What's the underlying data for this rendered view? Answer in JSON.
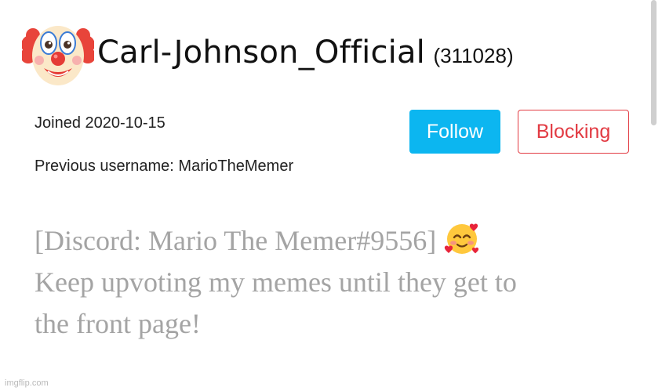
{
  "profile": {
    "username": "Carl-Johnson_Official",
    "user_id": "(311028)",
    "avatar_icon": "clown-face-emoji",
    "joined": "Joined 2020-10-15",
    "previous_username": "Previous username: MarioTheMemer"
  },
  "actions": {
    "follow_label": "Follow",
    "blocking_label": "Blocking"
  },
  "bio": {
    "line1": "[Discord: Mario The Memer#9556]",
    "line1_emoji": "smiling-face-with-hearts-emoji",
    "line2": "Keep upvoting my memes until they get to",
    "line3": "the front page!"
  },
  "watermark": "imgflip.com",
  "colors": {
    "follow_bg": "#0cb6f0",
    "blocking": "#e23b43",
    "bio_text": "#a4a4a4"
  }
}
